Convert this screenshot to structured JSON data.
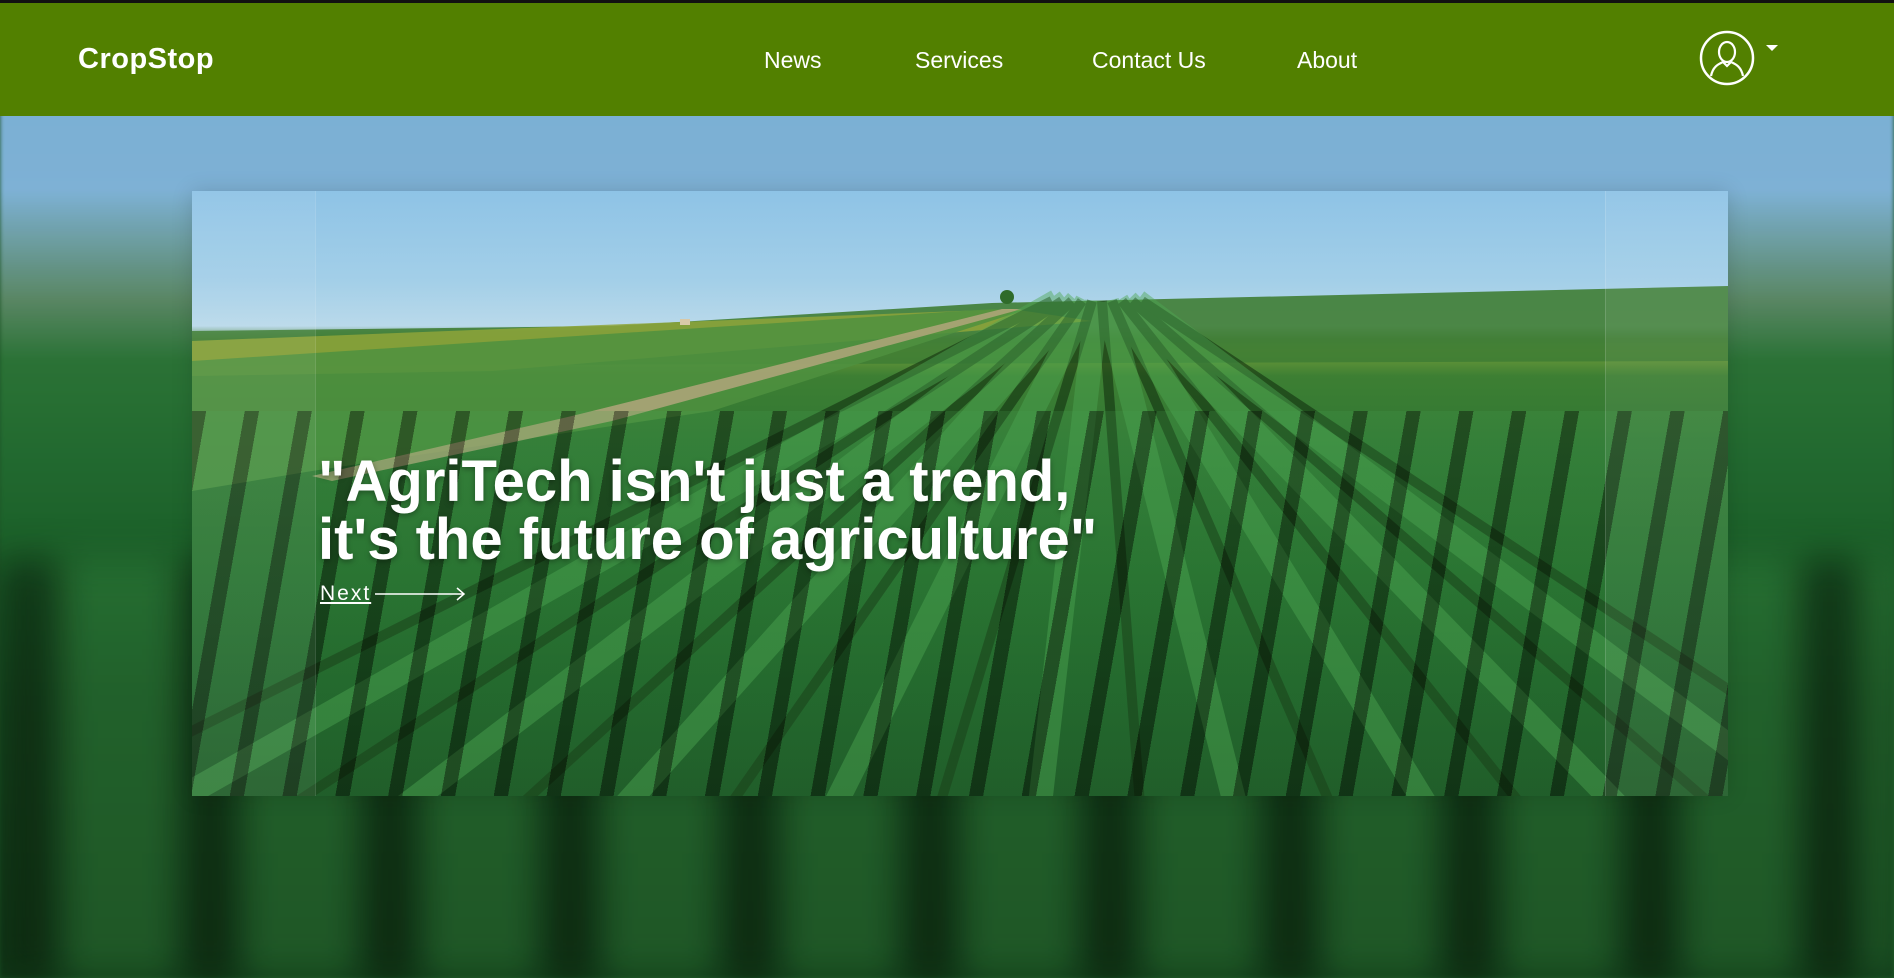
{
  "brand": {
    "name": "CropStop"
  },
  "nav": {
    "links": [
      {
        "label": "News"
      },
      {
        "label": "Services"
      },
      {
        "label": "Contact Us"
      },
      {
        "label": "About"
      }
    ]
  },
  "user_menu": {
    "icon": "user-avatar-icon"
  },
  "hero": {
    "caption_line1": "\"AgriTech isn't just a trend,",
    "caption_line2": "it's the future of agriculture\"",
    "next_label": "Next"
  },
  "colors": {
    "navbar": "#528000",
    "text": "#ffffff"
  }
}
